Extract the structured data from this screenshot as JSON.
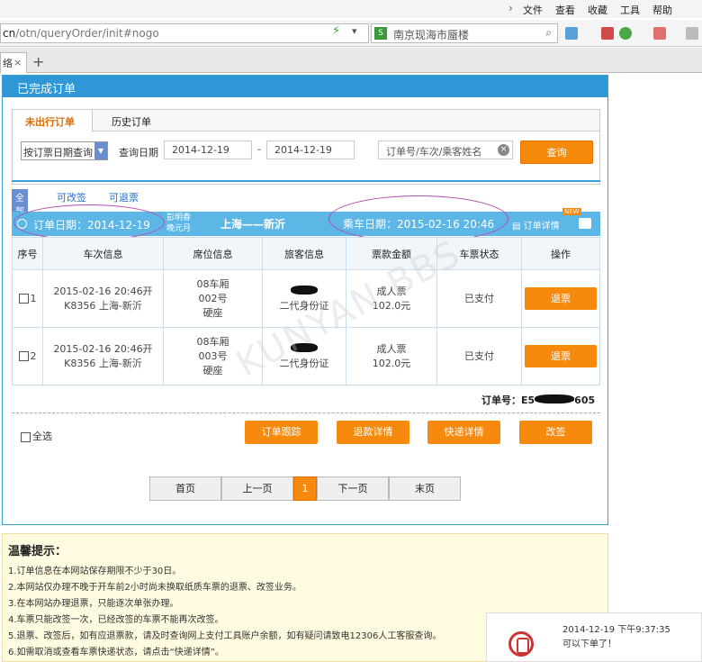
{
  "browser": {
    "menu": [
      "文件",
      "查看",
      "收藏",
      "工具",
      "帮助"
    ],
    "url_prefix": "cn",
    "url_path": "/otn/queryOrder/init#nogo",
    "search_text": "南京现海市蜃楼",
    "tab_title": "络",
    "new_tab": "+"
  },
  "panel": {
    "title": "已完成订单",
    "tabs": [
      "未出行订单",
      "历史订单"
    ],
    "query_type": "按订票日期查询",
    "date_label": "查询日期",
    "date_from": "2014-12-19",
    "date_to": "2014-12-19",
    "date_sep": "-",
    "keyword_placeholder": "订单号/车次/乘客姓名",
    "query_button": "查询",
    "filters": [
      "全部",
      "可改签",
      "可退票"
    ]
  },
  "order": {
    "order_date": "订单日期：2014-12-19",
    "promo_line1": "彭明春",
    "promo_line2": "晚元月",
    "route": "上海——新沂",
    "depart": "乘车日期：2015-02-16 20:46",
    "detail_link": "订单详情",
    "new_badge": "NEW",
    "columns": [
      "序号",
      "车次信息",
      "席位信息",
      "旅客信息",
      "票款金额",
      "车票状态",
      "操作"
    ],
    "rows": [
      {
        "index": "1",
        "train_line1": "2015-02-16 20:46开",
        "train_line2": "K8356 上海-新沂",
        "seat_line1": "08车厢",
        "seat_line2": "002号",
        "seat_line3": "硬座",
        "passenger_id": "二代身份证",
        "fare_type": "成人票",
        "fare": "102.0元",
        "status": "已支付",
        "action": "退票"
      },
      {
        "index": "2",
        "train_line1": "2015-02-16 20:46开",
        "train_line2": "K8356 上海-新沂",
        "seat_line1": "08车厢",
        "seat_line2": "003号",
        "seat_line3": "硬座",
        "passenger_id": "二代身份证",
        "fare_type": "成人票",
        "fare": "102.0元",
        "status": "已支付",
        "action": "退票"
      }
    ],
    "order_no_label": "订单号：E5",
    "order_no_tail": "605",
    "select_all": "全选",
    "actions": [
      "订单跟踪",
      "退款详情",
      "快递详情",
      "改签"
    ]
  },
  "pager": [
    "首页",
    "上一页",
    "1",
    "下一页",
    "末页"
  ],
  "tips": {
    "title": "温馨提示：",
    "lines": [
      "1.订单信息在本网站保存期限不少于30日。",
      "2.本网站仅办理不晚于开车前2小时尚未换取纸质车票的退票、改签业务。",
      "3.在本网站办理退票，只能逐次单张办理。",
      "4.车票只能改签一次，已经改签的车票不能再次改签。",
      "5.退票、改签后，如有应退票款，请及时查询网上支付工具账户余额，如有疑问请致电12306人工客服查询。",
      "6.如需取消或查看车票快递状态，请点击“快递详情”。"
    ]
  },
  "chat": {
    "time": "2014-12-19 下午9:37:35",
    "message": "可以下单了！"
  },
  "watermark": "KUNYAN BBS"
}
